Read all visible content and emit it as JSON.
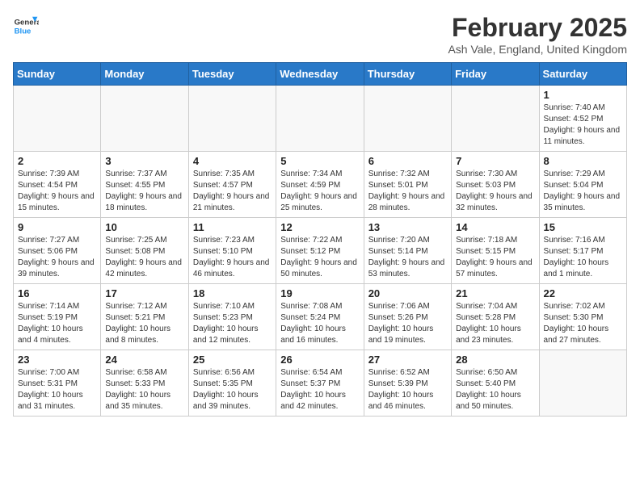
{
  "header": {
    "logo_line1": "General",
    "logo_line2": "Blue",
    "month": "February 2025",
    "location": "Ash Vale, England, United Kingdom"
  },
  "weekdays": [
    "Sunday",
    "Monday",
    "Tuesday",
    "Wednesday",
    "Thursday",
    "Friday",
    "Saturday"
  ],
  "weeks": [
    [
      {
        "day": "",
        "info": ""
      },
      {
        "day": "",
        "info": ""
      },
      {
        "day": "",
        "info": ""
      },
      {
        "day": "",
        "info": ""
      },
      {
        "day": "",
        "info": ""
      },
      {
        "day": "",
        "info": ""
      },
      {
        "day": "1",
        "info": "Sunrise: 7:40 AM\nSunset: 4:52 PM\nDaylight: 9 hours and 11 minutes."
      }
    ],
    [
      {
        "day": "2",
        "info": "Sunrise: 7:39 AM\nSunset: 4:54 PM\nDaylight: 9 hours and 15 minutes."
      },
      {
        "day": "3",
        "info": "Sunrise: 7:37 AM\nSunset: 4:55 PM\nDaylight: 9 hours and 18 minutes."
      },
      {
        "day": "4",
        "info": "Sunrise: 7:35 AM\nSunset: 4:57 PM\nDaylight: 9 hours and 21 minutes."
      },
      {
        "day": "5",
        "info": "Sunrise: 7:34 AM\nSunset: 4:59 PM\nDaylight: 9 hours and 25 minutes."
      },
      {
        "day": "6",
        "info": "Sunrise: 7:32 AM\nSunset: 5:01 PM\nDaylight: 9 hours and 28 minutes."
      },
      {
        "day": "7",
        "info": "Sunrise: 7:30 AM\nSunset: 5:03 PM\nDaylight: 9 hours and 32 minutes."
      },
      {
        "day": "8",
        "info": "Sunrise: 7:29 AM\nSunset: 5:04 PM\nDaylight: 9 hours and 35 minutes."
      }
    ],
    [
      {
        "day": "9",
        "info": "Sunrise: 7:27 AM\nSunset: 5:06 PM\nDaylight: 9 hours and 39 minutes."
      },
      {
        "day": "10",
        "info": "Sunrise: 7:25 AM\nSunset: 5:08 PM\nDaylight: 9 hours and 42 minutes."
      },
      {
        "day": "11",
        "info": "Sunrise: 7:23 AM\nSunset: 5:10 PM\nDaylight: 9 hours and 46 minutes."
      },
      {
        "day": "12",
        "info": "Sunrise: 7:22 AM\nSunset: 5:12 PM\nDaylight: 9 hours and 50 minutes."
      },
      {
        "day": "13",
        "info": "Sunrise: 7:20 AM\nSunset: 5:14 PM\nDaylight: 9 hours and 53 minutes."
      },
      {
        "day": "14",
        "info": "Sunrise: 7:18 AM\nSunset: 5:15 PM\nDaylight: 9 hours and 57 minutes."
      },
      {
        "day": "15",
        "info": "Sunrise: 7:16 AM\nSunset: 5:17 PM\nDaylight: 10 hours and 1 minute."
      }
    ],
    [
      {
        "day": "16",
        "info": "Sunrise: 7:14 AM\nSunset: 5:19 PM\nDaylight: 10 hours and 4 minutes."
      },
      {
        "day": "17",
        "info": "Sunrise: 7:12 AM\nSunset: 5:21 PM\nDaylight: 10 hours and 8 minutes."
      },
      {
        "day": "18",
        "info": "Sunrise: 7:10 AM\nSunset: 5:23 PM\nDaylight: 10 hours and 12 minutes."
      },
      {
        "day": "19",
        "info": "Sunrise: 7:08 AM\nSunset: 5:24 PM\nDaylight: 10 hours and 16 minutes."
      },
      {
        "day": "20",
        "info": "Sunrise: 7:06 AM\nSunset: 5:26 PM\nDaylight: 10 hours and 19 minutes."
      },
      {
        "day": "21",
        "info": "Sunrise: 7:04 AM\nSunset: 5:28 PM\nDaylight: 10 hours and 23 minutes."
      },
      {
        "day": "22",
        "info": "Sunrise: 7:02 AM\nSunset: 5:30 PM\nDaylight: 10 hours and 27 minutes."
      }
    ],
    [
      {
        "day": "23",
        "info": "Sunrise: 7:00 AM\nSunset: 5:31 PM\nDaylight: 10 hours and 31 minutes."
      },
      {
        "day": "24",
        "info": "Sunrise: 6:58 AM\nSunset: 5:33 PM\nDaylight: 10 hours and 35 minutes."
      },
      {
        "day": "25",
        "info": "Sunrise: 6:56 AM\nSunset: 5:35 PM\nDaylight: 10 hours and 39 minutes."
      },
      {
        "day": "26",
        "info": "Sunrise: 6:54 AM\nSunset: 5:37 PM\nDaylight: 10 hours and 42 minutes."
      },
      {
        "day": "27",
        "info": "Sunrise: 6:52 AM\nSunset: 5:39 PM\nDaylight: 10 hours and 46 minutes."
      },
      {
        "day": "28",
        "info": "Sunrise: 6:50 AM\nSunset: 5:40 PM\nDaylight: 10 hours and 50 minutes."
      },
      {
        "day": "",
        "info": ""
      }
    ]
  ]
}
